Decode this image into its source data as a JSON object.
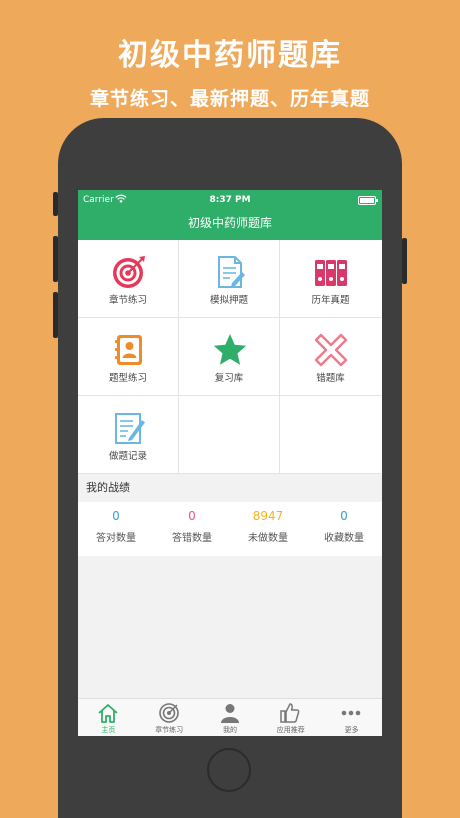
{
  "promo": {
    "title": "初级中药师题库",
    "subtitle": "章节练习、最新押题、历年真题"
  },
  "status_bar": {
    "carrier": "Carrier",
    "time": "8:37 PM"
  },
  "nav": {
    "title": "初级中药师题库"
  },
  "grid": [
    {
      "label": "章节练习",
      "icon": "target-icon"
    },
    {
      "label": "模拟押题",
      "icon": "document-edit-icon"
    },
    {
      "label": "历年真题",
      "icon": "binders-icon"
    },
    {
      "label": "题型练习",
      "icon": "contact-book-icon"
    },
    {
      "label": "复习库",
      "icon": "star-icon"
    },
    {
      "label": "错题库",
      "icon": "cross-icon"
    },
    {
      "label": "做题记录",
      "icon": "notepad-pen-icon"
    }
  ],
  "stats_section": {
    "title": "我的战绩"
  },
  "stats": [
    {
      "value": "0",
      "label": "答对数量",
      "color": "#3A9BDC"
    },
    {
      "value": "0",
      "label": "答错数量",
      "color": "#E8548A"
    },
    {
      "value": "8947",
      "label": "未做数量",
      "color": "#F2B321"
    },
    {
      "value": "0",
      "label": "收藏数量",
      "color": "#3A9BDC"
    }
  ],
  "tabs": [
    {
      "label": "主页",
      "icon": "home-icon",
      "active": true
    },
    {
      "label": "章节练习",
      "icon": "target-icon",
      "active": false
    },
    {
      "label": "我的",
      "icon": "person-icon",
      "active": false
    },
    {
      "label": "应用推荐",
      "icon": "thumbs-up-icon",
      "active": false
    },
    {
      "label": "更多",
      "icon": "more-dots-icon",
      "active": false
    }
  ],
  "colors": {
    "background": "#EEA95B",
    "brand": "#2FAE6A",
    "target_red": "#E8385A",
    "document_blue": "#6CB7E2",
    "binder_pink": "#D9386A",
    "contact_orange": "#EE8B2A",
    "star_green": "#2FAE6A",
    "cross_pink": "#F07A8A"
  }
}
